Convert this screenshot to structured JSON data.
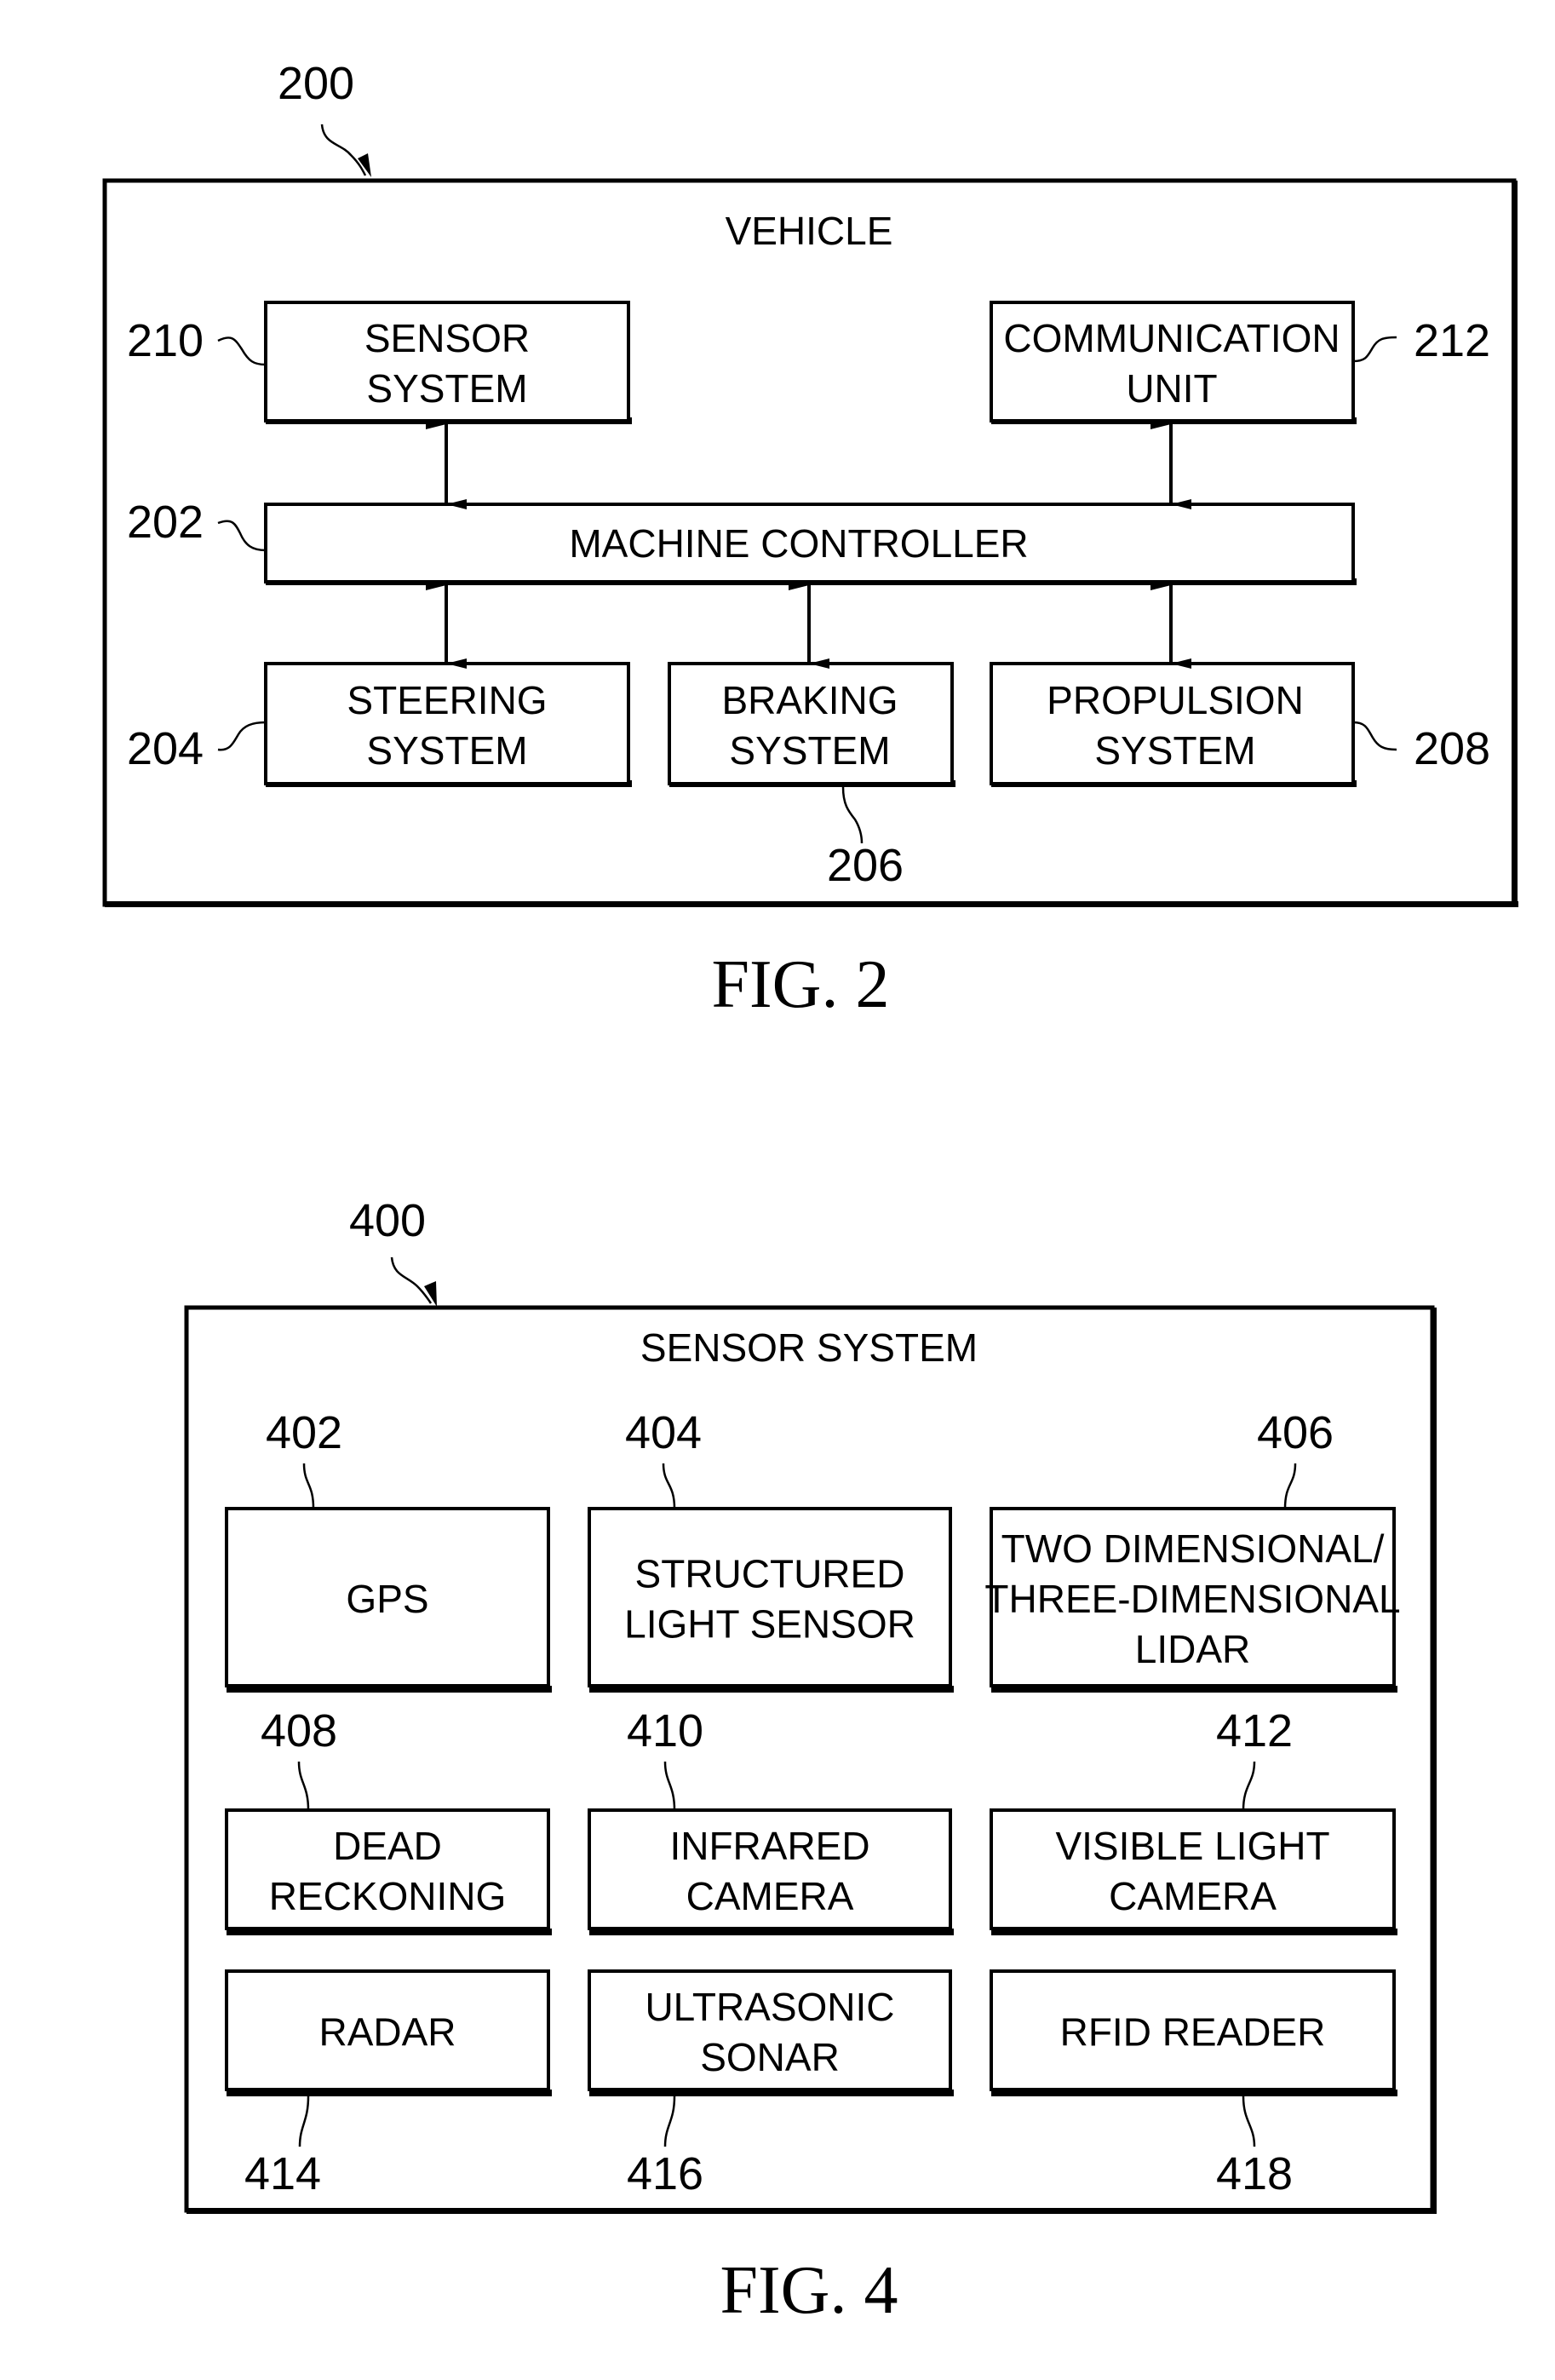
{
  "figures": [
    {
      "caption": "FIG. 2",
      "ref": "200",
      "container_title": "VEHICLE",
      "blocks": [
        {
          "id": "sensor",
          "ref": "210",
          "lines": [
            "SENSOR",
            "SYSTEM"
          ]
        },
        {
          "id": "comm",
          "ref": "212",
          "lines": [
            "COMMUNICATION",
            "UNIT"
          ]
        },
        {
          "id": "controller",
          "ref": "202",
          "lines": [
            "MACHINE CONTROLLER"
          ]
        },
        {
          "id": "steering",
          "ref": "204",
          "lines": [
            "STEERING",
            "SYSTEM"
          ]
        },
        {
          "id": "braking",
          "ref": "206",
          "lines": [
            "BRAKING",
            "SYSTEM"
          ]
        },
        {
          "id": "propulsion",
          "ref": "208",
          "lines": [
            "PROPULSION",
            "SYSTEM"
          ]
        }
      ],
      "connections": [
        {
          "from": "sensor",
          "to": "controller",
          "type": "bidirectional"
        },
        {
          "from": "comm",
          "to": "controller",
          "type": "bidirectional"
        },
        {
          "from": "controller",
          "to": "steering",
          "type": "bidirectional"
        },
        {
          "from": "controller",
          "to": "braking",
          "type": "bidirectional"
        },
        {
          "from": "controller",
          "to": "propulsion",
          "type": "bidirectional"
        }
      ]
    },
    {
      "caption": "FIG. 4",
      "ref": "400",
      "container_title": "SENSOR SYSTEM",
      "blocks": [
        {
          "id": "gps",
          "ref": "402",
          "lines": [
            "GPS"
          ]
        },
        {
          "id": "structured",
          "ref": "404",
          "lines": [
            "STRUCTURED",
            "LIGHT SENSOR"
          ]
        },
        {
          "id": "lidar",
          "ref": "406",
          "lines": [
            "TWO DIMENSIONAL/",
            "THREE-DIMENSIONAL",
            "LIDAR"
          ]
        },
        {
          "id": "dead",
          "ref": "408",
          "lines": [
            "DEAD",
            "RECKONING"
          ]
        },
        {
          "id": "infrared",
          "ref": "410",
          "lines": [
            "INFRARED",
            "CAMERA"
          ]
        },
        {
          "id": "visible",
          "ref": "412",
          "lines": [
            "VISIBLE LIGHT",
            "CAMERA"
          ]
        },
        {
          "id": "radar",
          "ref": "414",
          "lines": [
            "RADAR"
          ]
        },
        {
          "id": "sonar",
          "ref": "416",
          "lines": [
            "ULTRASONIC",
            "SONAR"
          ]
        },
        {
          "id": "rfid",
          "ref": "418",
          "lines": [
            "RFID READER"
          ]
        }
      ]
    }
  ]
}
